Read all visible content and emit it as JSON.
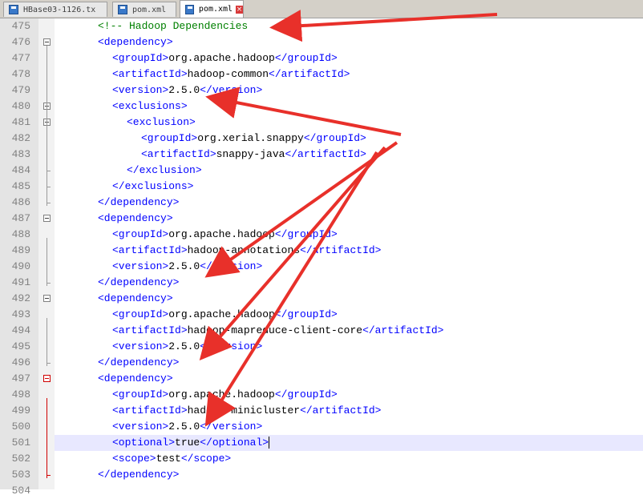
{
  "tabs": [
    {
      "label": "HBase03-1126.tx"
    },
    {
      "label": "pom.xml"
    },
    {
      "label": "pom.xml",
      "active": true
    }
  ],
  "accent": "#e8302a",
  "lines": [
    {
      "num": "475",
      "tokens": [
        {
          "t": "cmt",
          "v": "<!-- Hadoop Dependencies"
        }
      ],
      "indent": 3
    },
    {
      "num": "476",
      "tokens": [
        {
          "t": "tag",
          "v": "<dependency>"
        }
      ],
      "indent": 3
    },
    {
      "num": "477",
      "tokens": [
        {
          "t": "tag",
          "v": "<groupId>"
        },
        {
          "t": "txt",
          "v": "org.apache.hadoop"
        },
        {
          "t": "tag",
          "v": "</groupId>"
        }
      ],
      "indent": 4
    },
    {
      "num": "478",
      "tokens": [
        {
          "t": "tag",
          "v": "<artifactId>"
        },
        {
          "t": "txt",
          "v": "hadoop-common"
        },
        {
          "t": "tag",
          "v": "</artifactId>"
        }
      ],
      "indent": 4
    },
    {
      "num": "479",
      "tokens": [
        {
          "t": "tag",
          "v": "<version>"
        },
        {
          "t": "txt",
          "v": "2.5.0"
        },
        {
          "t": "tag",
          "v": "</version>"
        }
      ],
      "indent": 4
    },
    {
      "num": "480",
      "tokens": [
        {
          "t": "tag",
          "v": "<exclusions>"
        }
      ],
      "indent": 4
    },
    {
      "num": "481",
      "tokens": [
        {
          "t": "tag",
          "v": "<exclusion>"
        }
      ],
      "indent": 5
    },
    {
      "num": "482",
      "tokens": [
        {
          "t": "tag",
          "v": "<groupId>"
        },
        {
          "t": "txt",
          "v": "org.xerial.snappy"
        },
        {
          "t": "tag",
          "v": "</groupId>"
        }
      ],
      "indent": 6
    },
    {
      "num": "483",
      "tokens": [
        {
          "t": "tag",
          "v": "<artifactId>"
        },
        {
          "t": "txt",
          "v": "snappy-java"
        },
        {
          "t": "tag",
          "v": "</artifactId>"
        }
      ],
      "indent": 6
    },
    {
      "num": "484",
      "tokens": [
        {
          "t": "tag",
          "v": "</exclusion>"
        }
      ],
      "indent": 5
    },
    {
      "num": "485",
      "tokens": [
        {
          "t": "tag",
          "v": "</exclusions>"
        }
      ],
      "indent": 4
    },
    {
      "num": "486",
      "tokens": [
        {
          "t": "tag",
          "v": "</dependency>"
        }
      ],
      "indent": 3
    },
    {
      "num": "487",
      "tokens": [
        {
          "t": "tag",
          "v": "<dependency>"
        }
      ],
      "indent": 3
    },
    {
      "num": "488",
      "tokens": [
        {
          "t": "tag",
          "v": "<groupId>"
        },
        {
          "t": "txt",
          "v": "org.apache.hadoop"
        },
        {
          "t": "tag",
          "v": "</groupId>"
        }
      ],
      "indent": 4
    },
    {
      "num": "489",
      "tokens": [
        {
          "t": "tag",
          "v": "<artifactId>"
        },
        {
          "t": "txt",
          "v": "hadoop-annotations"
        },
        {
          "t": "tag",
          "v": "</artifactId>"
        }
      ],
      "indent": 4
    },
    {
      "num": "490",
      "tokens": [
        {
          "t": "tag",
          "v": "<version>"
        },
        {
          "t": "txt",
          "v": "2.5.0"
        },
        {
          "t": "tag",
          "v": "</version>"
        }
      ],
      "indent": 4
    },
    {
      "num": "491",
      "tokens": [
        {
          "t": "tag",
          "v": "</dependency>"
        }
      ],
      "indent": 3
    },
    {
      "num": "492",
      "tokens": [
        {
          "t": "tag",
          "v": "<dependency>"
        }
      ],
      "indent": 3
    },
    {
      "num": "493",
      "tokens": [
        {
          "t": "tag",
          "v": "<groupId>"
        },
        {
          "t": "txt",
          "v": "org.apache.hadoop"
        },
        {
          "t": "tag",
          "v": "</groupId>"
        }
      ],
      "indent": 4
    },
    {
      "num": "494",
      "tokens": [
        {
          "t": "tag",
          "v": "<artifactId>"
        },
        {
          "t": "txt",
          "v": "hadoop-mapreduce-client-core"
        },
        {
          "t": "tag",
          "v": "</artifactId>"
        }
      ],
      "indent": 4
    },
    {
      "num": "495",
      "tokens": [
        {
          "t": "tag",
          "v": "<version>"
        },
        {
          "t": "txt",
          "v": "2.5.0"
        },
        {
          "t": "tag",
          "v": "</version>"
        }
      ],
      "indent": 4
    },
    {
      "num": "496",
      "tokens": [
        {
          "t": "tag",
          "v": "</dependency>"
        }
      ],
      "indent": 3
    },
    {
      "num": "497",
      "tokens": [
        {
          "t": "tag",
          "v": "<dependency>"
        }
      ],
      "indent": 3
    },
    {
      "num": "498",
      "tokens": [
        {
          "t": "tag",
          "v": "<groupId>"
        },
        {
          "t": "txt",
          "v": "org.apache.hadoop"
        },
        {
          "t": "tag",
          "v": "</groupId>"
        }
      ],
      "indent": 4
    },
    {
      "num": "499",
      "tokens": [
        {
          "t": "tag",
          "v": "<artifactId>"
        },
        {
          "t": "txt",
          "v": "hadoop-minicluster"
        },
        {
          "t": "tag",
          "v": "</artifactId>"
        }
      ],
      "indent": 4
    },
    {
      "num": "500",
      "tokens": [
        {
          "t": "tag",
          "v": "<version>"
        },
        {
          "t": "txt",
          "v": "2.5.0"
        },
        {
          "t": "tag",
          "v": "</version>"
        }
      ],
      "indent": 4
    },
    {
      "num": "501",
      "tokens": [
        {
          "t": "tag",
          "v": "<optional>"
        },
        {
          "t": "txt",
          "v": "true"
        },
        {
          "t": "tag",
          "v": "</optional>"
        }
      ],
      "indent": 4,
      "current": true
    },
    {
      "num": "502",
      "tokens": [
        {
          "t": "tag",
          "v": "<scope>"
        },
        {
          "t": "txt",
          "v": "test"
        },
        {
          "t": "tag",
          "v": "</scope>"
        }
      ],
      "indent": 4
    },
    {
      "num": "503",
      "tokens": [
        {
          "t": "tag",
          "v": "</dependency>"
        }
      ],
      "indent": 3
    },
    {
      "num": "504",
      "tokens": [],
      "indent": 0
    }
  ]
}
